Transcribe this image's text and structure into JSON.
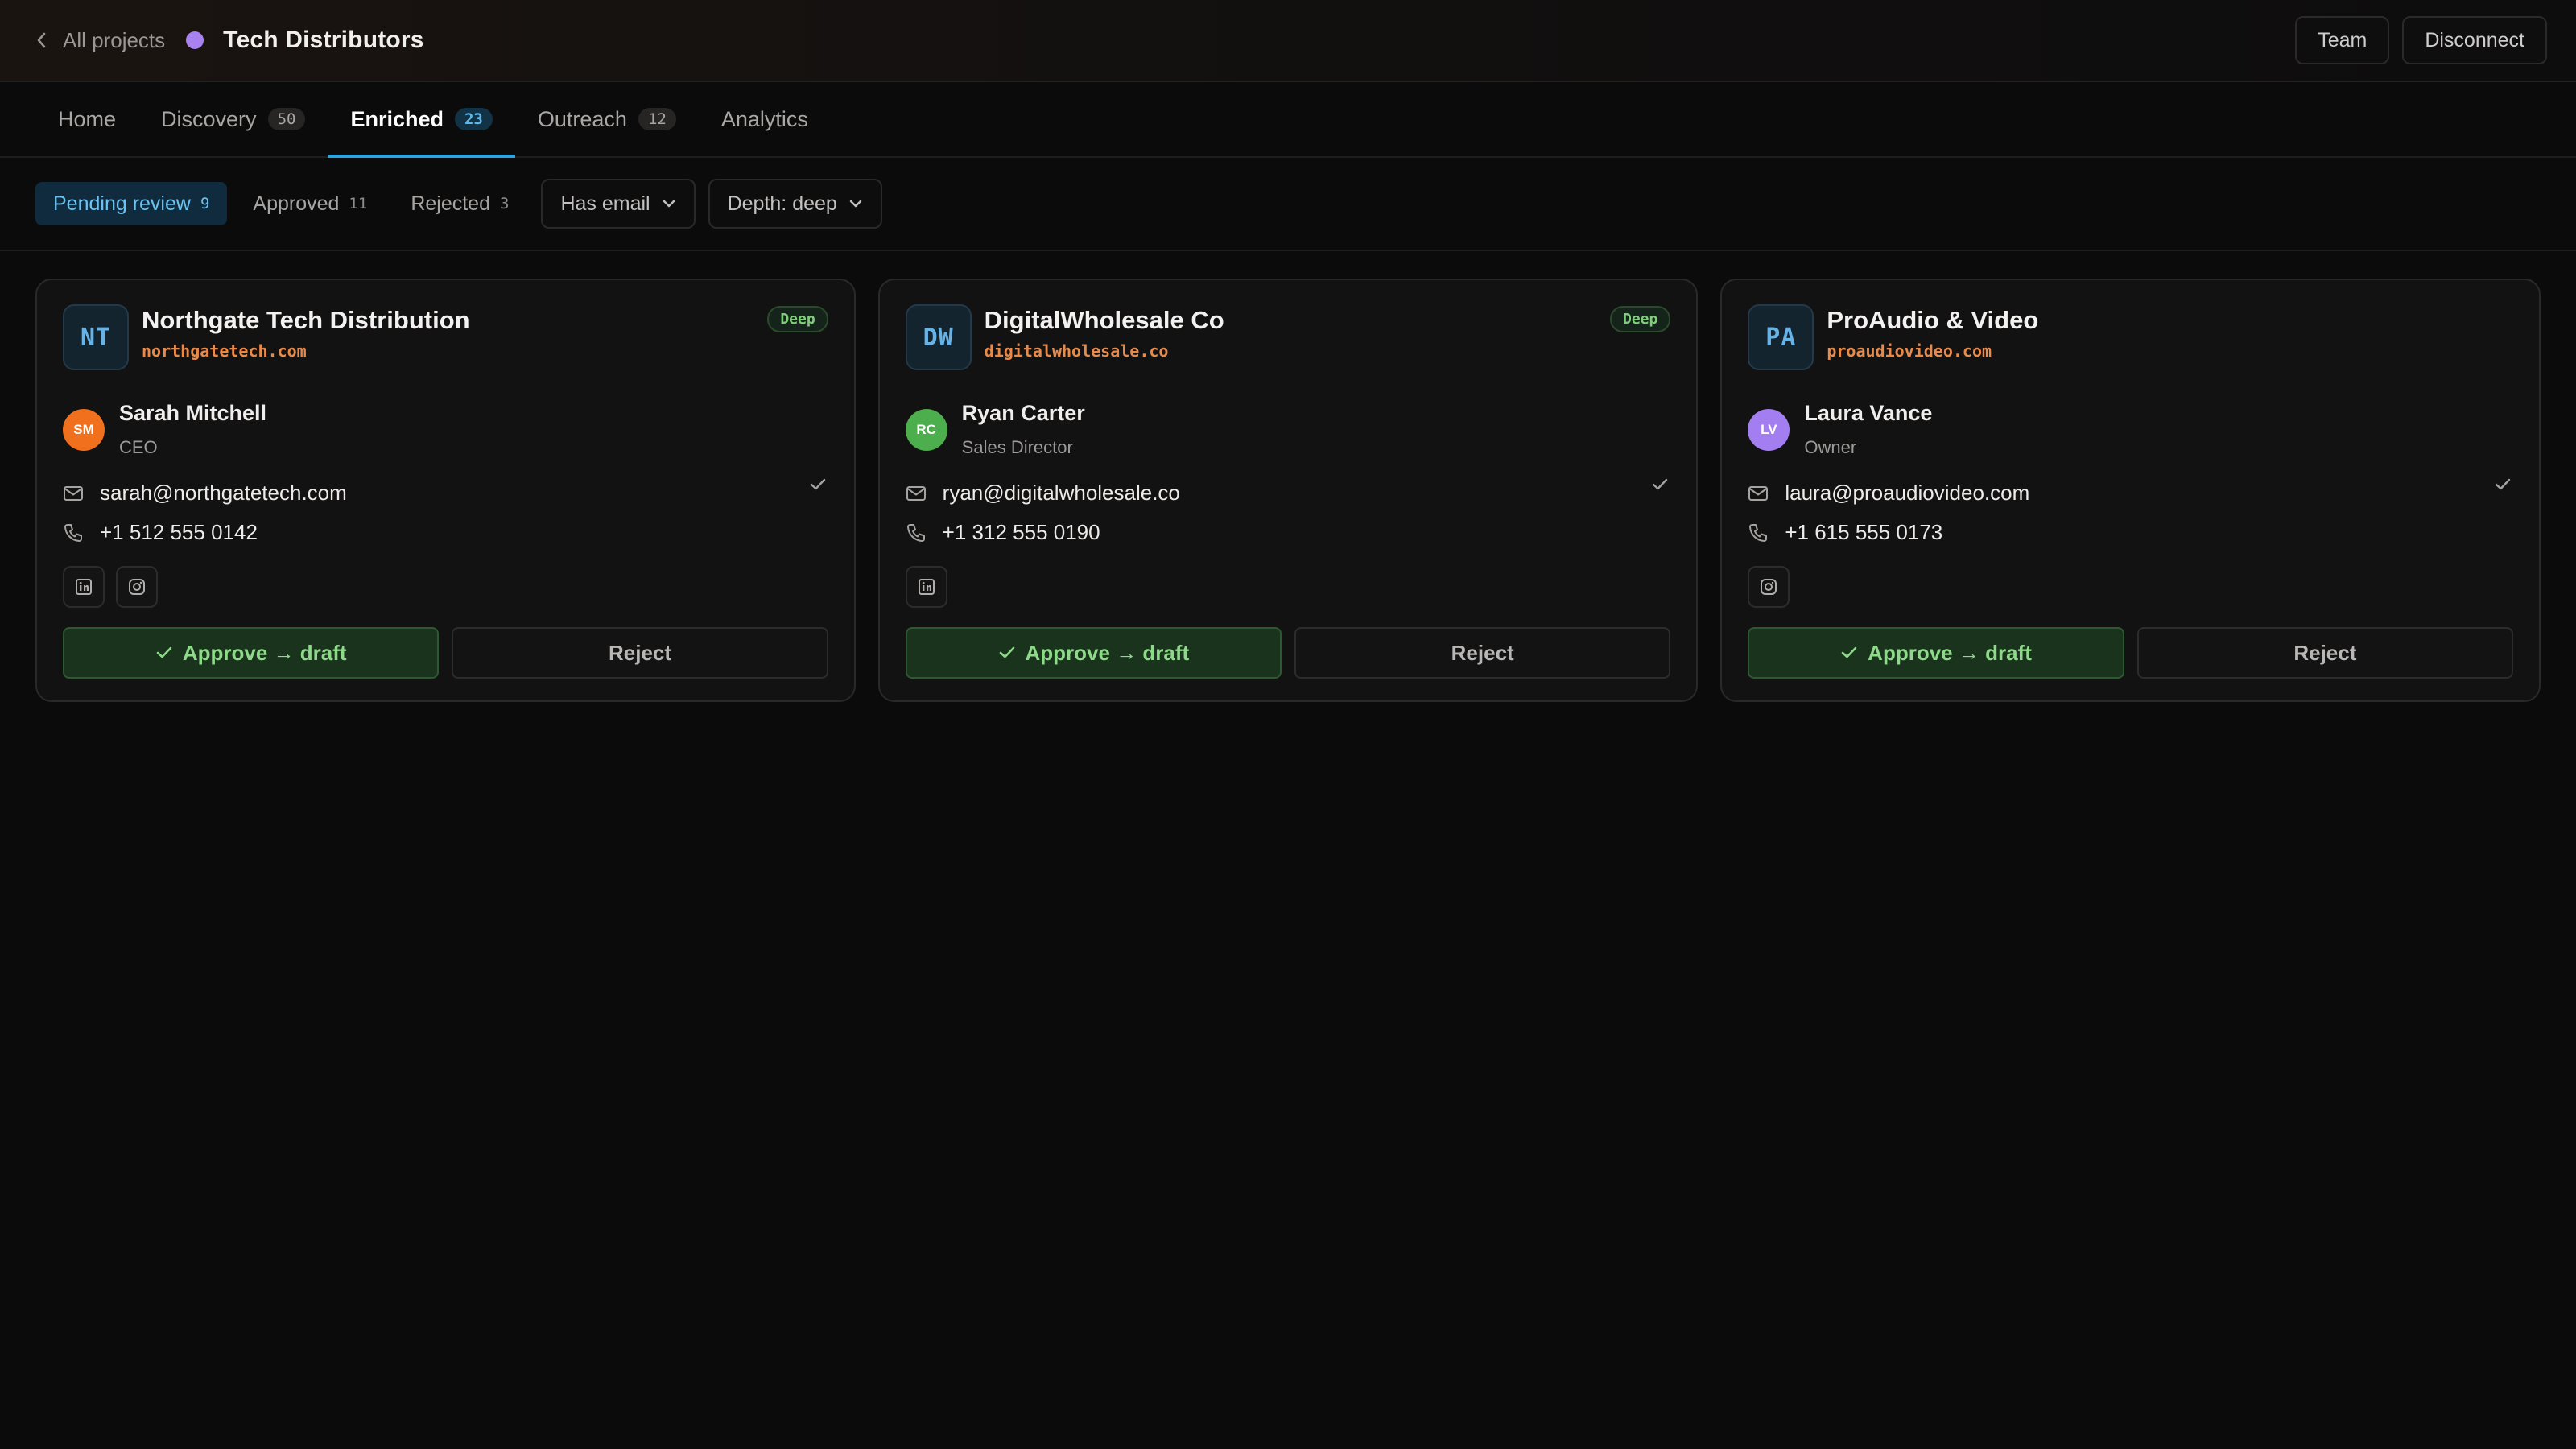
{
  "header": {
    "back_label": "All projects",
    "project_title": "Tech Distributors",
    "project_dot_color": "#a883f0",
    "team_label": "Team",
    "disconnect_label": "Disconnect"
  },
  "tabs": [
    {
      "label": "Home",
      "count": null,
      "active": false
    },
    {
      "label": "Discovery",
      "count": "50",
      "active": false
    },
    {
      "label": "Enriched",
      "count": "23",
      "active": true
    },
    {
      "label": "Outreach",
      "count": "12",
      "active": false
    },
    {
      "label": "Analytics",
      "count": null,
      "active": false
    }
  ],
  "filters": {
    "pending": {
      "label": "Pending review",
      "count": "9"
    },
    "approved": {
      "label": "Approved",
      "count": "11"
    },
    "rejected": {
      "label": "Rejected",
      "count": "3"
    },
    "has_email": "Has email",
    "depth": "Depth: deep"
  },
  "cards": [
    {
      "initials": "NT",
      "company": "Northgate Tech Distribution",
      "domain": "northgatetech.com",
      "badge": "Deep",
      "person_initials": "SM",
      "avatar_color": "#f0701e",
      "person_name": "Sarah Mitchell",
      "person_role": "CEO",
      "email": "sarah@northgatetech.com",
      "phone": "+1 512 555 0142",
      "socials": [
        "linkedin-icon",
        "instagram-icon"
      ],
      "approve_label": "Approve → draft",
      "reject_label": "Reject"
    },
    {
      "initials": "DW",
      "company": "DigitalWholesale Co",
      "domain": "digitalwholesale.co",
      "badge": "Deep",
      "person_initials": "RC",
      "avatar_color": "#4cae4c",
      "person_name": "Ryan Carter",
      "person_role": "Sales Director",
      "email": "ryan@digitalwholesale.co",
      "phone": "+1 312 555 0190",
      "socials": [
        "linkedin-icon"
      ],
      "approve_label": "Approve → draft",
      "reject_label": "Reject"
    },
    {
      "initials": "PA",
      "company": "ProAudio & Video",
      "domain": "proaudiovideo.com",
      "badge": "",
      "person_initials": "LV",
      "avatar_color": "#a37ef0",
      "person_name": "Laura Vance",
      "person_role": "Owner",
      "email": "laura@proaudiovideo.com",
      "phone": "+1 615 555 0173",
      "socials": [
        "instagram-icon"
      ],
      "approve_label": "Approve → draft",
      "reject_label": "Reject"
    }
  ]
}
